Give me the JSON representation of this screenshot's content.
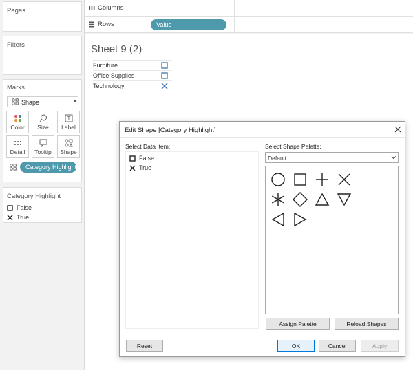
{
  "shelves": {
    "columns_label": "Columns",
    "rows_label": "Rows",
    "rows_pill": "Value"
  },
  "left": {
    "pages_title": "Pages",
    "filters_title": "Filters",
    "marks_title": "Marks",
    "mark_type": "Shape",
    "mark_buttons": {
      "color": "Color",
      "size": "Size",
      "label": "Label",
      "detail": "Detail",
      "tooltip": "Tooltip",
      "shape": "Shape"
    },
    "shape_pill": "Category Highlight",
    "legend_title": "Category Highlight",
    "legend_items": [
      "False",
      "True"
    ]
  },
  "sheet": {
    "title": "Sheet 9 (2)",
    "categories": [
      "Furniture",
      "Office Supplies",
      "Technology"
    ]
  },
  "dialog": {
    "title": "Edit Shape [Category Highlight]",
    "data_item_label": "Select Data Item:",
    "data_items": [
      "False",
      "True"
    ],
    "palette_label": "Select Shape Palette:",
    "palette_value": "Default",
    "shapes": [
      "circle-shape",
      "square-shape",
      "plus-shape",
      "cross-shape",
      "asterisk-shape",
      "diamond-shape",
      "triangle-up-shape",
      "triangle-down-shape",
      "triangle-left-shape",
      "triangle-right-shape"
    ],
    "buttons": {
      "assign": "Assign Palette",
      "reload": "Reload Shapes",
      "reset": "Reset",
      "ok": "OK",
      "cancel": "Cancel",
      "apply": "Apply"
    }
  },
  "colors": {
    "pill": "#4e9aac",
    "square_mark": "#4a7db5",
    "cross_mark": "#4a7db5",
    "ok_border": "#0078d7"
  }
}
